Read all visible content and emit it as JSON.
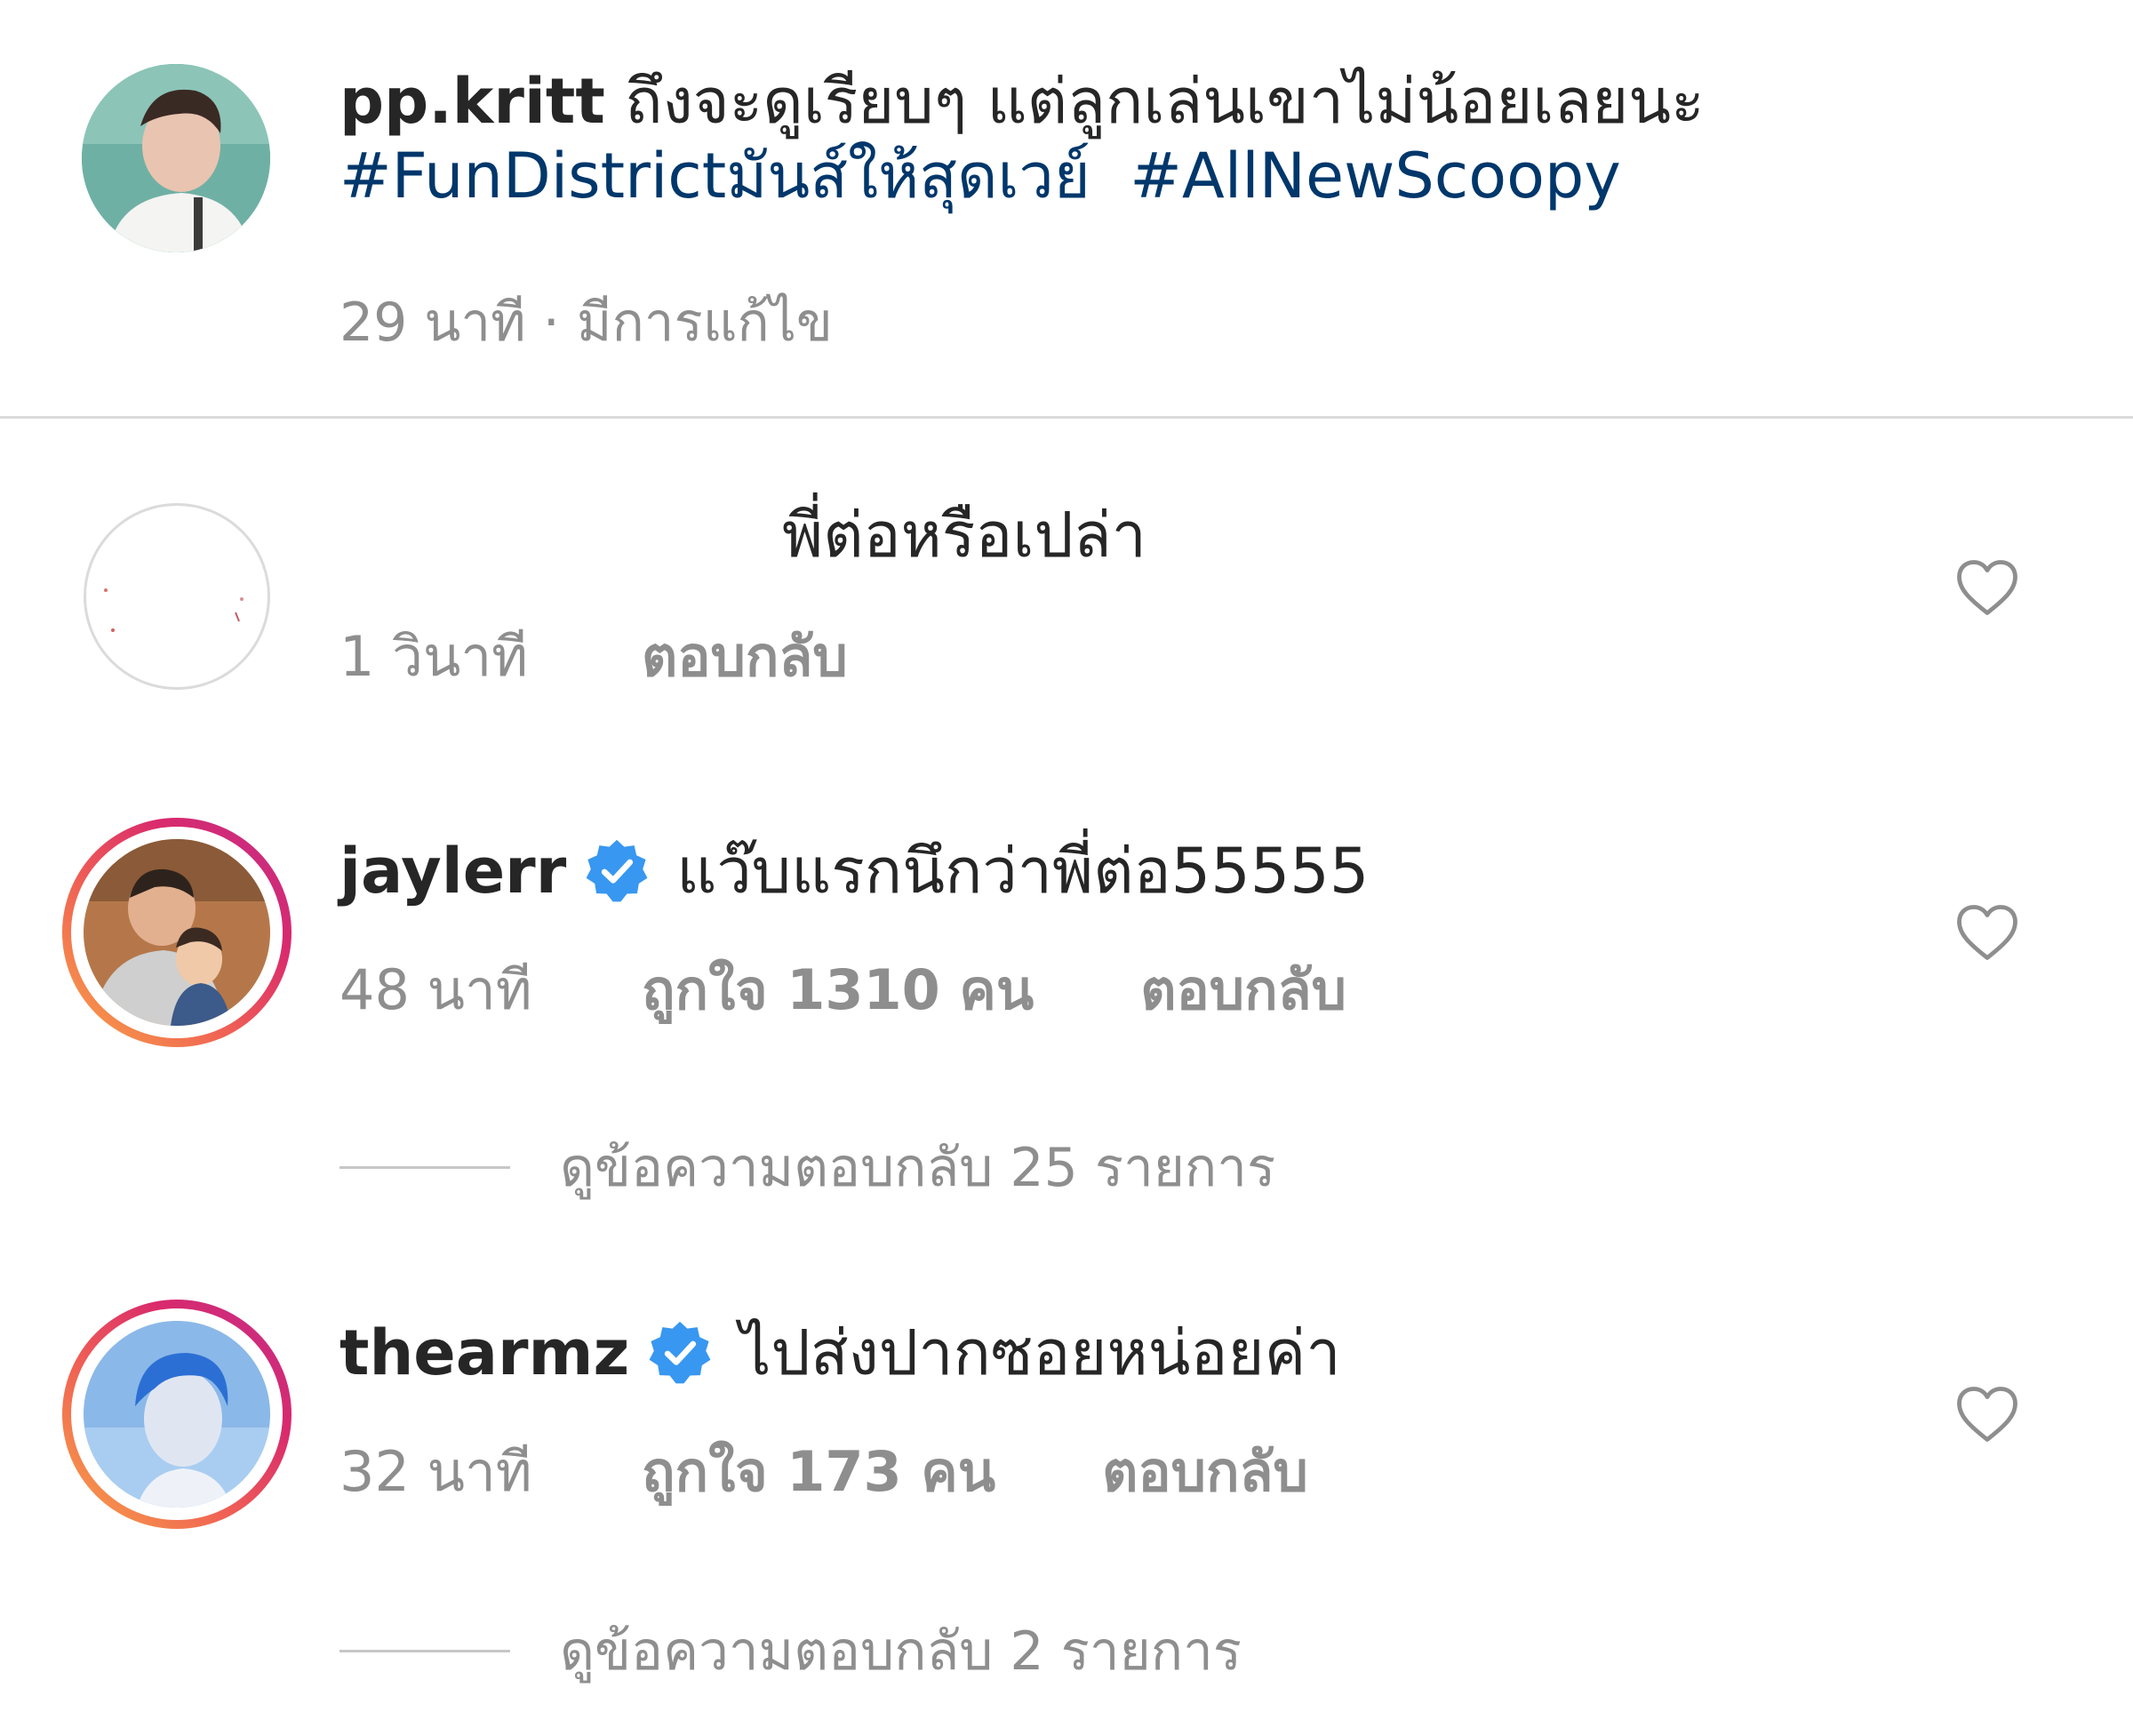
{
  "caption": {
    "username": "pp.kritt",
    "text": "ถึงจะดูเรียบๆ แต่ลูกเล่นเขาไม่น้อยเลยนะ",
    "hashtags": [
      "#FunDistrictมันส์ให้สุดเวย์",
      "#AllNewScoopy"
    ],
    "meta": "29 นาที · มีการแก้ไข"
  },
  "comments": [
    {
      "username": "",
      "text": "พี่ต่อหรือเปล่า",
      "time": "1 วินาที",
      "likes": "",
      "reply_label": "ตอบกลับ",
      "verified": false
    },
    {
      "username": "jaylerr",
      "text": "แว๊บแรกนึกว่าพี่ต่อ55555",
      "time": "48 นาที",
      "likes": "ถูกใจ 1310 คน",
      "reply_label": "ตอบกลับ",
      "verified": true,
      "view_replies": "ดูข้อความตอบกลับ 25 รายการ"
    },
    {
      "username": "thearmz",
      "text": "ไปส่งปากซอยหน่อยค่า",
      "time": "32 นาที",
      "likes": "ถูกใจ 173 คน",
      "reply_label": "ตอบกลับ",
      "verified": true,
      "view_replies": "ดูข้อความตอบกลับ 2 รายการ"
    }
  ],
  "colors": {
    "text": "#262626",
    "secondary": "#8e8e8e",
    "hashtag": "#00376b",
    "verified": "#3897f0",
    "divider": "#dbdbdb"
  },
  "icons": {
    "heart": "heart-outline-icon",
    "verified": "verified-badge-icon"
  }
}
